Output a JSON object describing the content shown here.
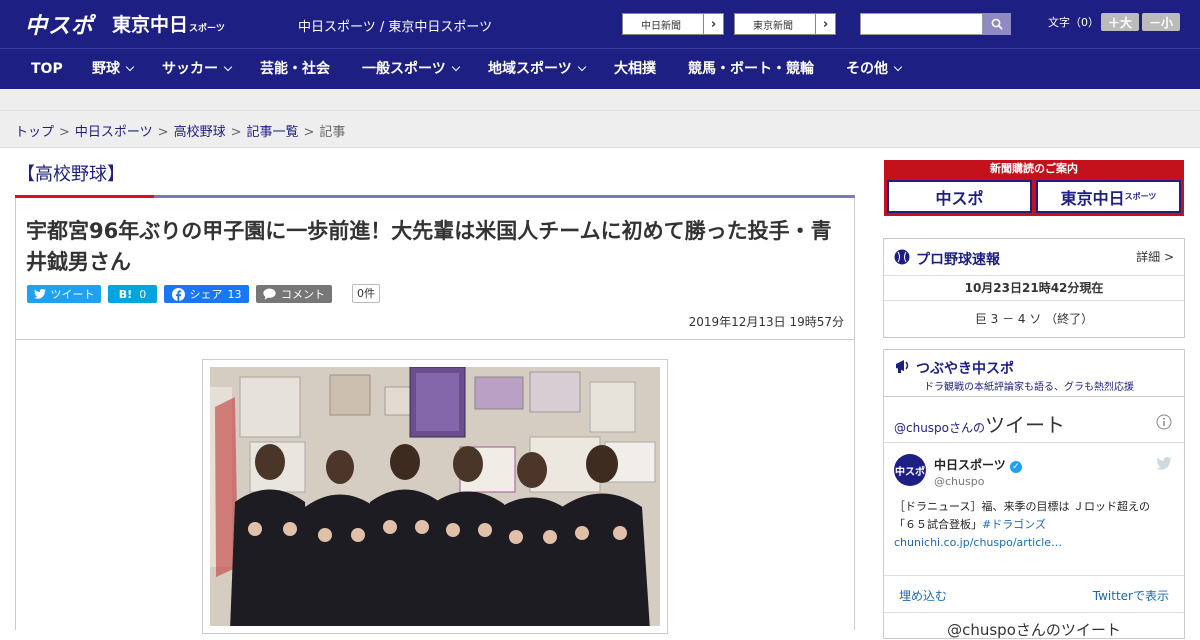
{
  "header": {
    "logo_main": "中スポ",
    "logo_tokyo": "東京中日",
    "logo_tokyo_sub": "スポーツ",
    "site_links": "中日スポーツ / 東京中日スポーツ",
    "newspaper1": "中日新聞",
    "newspaper2": "東京新聞",
    "search_placeholder": "",
    "font_size_label": "文字（0）",
    "font_larger": "＋大",
    "font_smaller": "－小"
  },
  "nav": [
    {
      "label": "TOP"
    },
    {
      "label": "野球"
    },
    {
      "label": "サッカー"
    },
    {
      "label": "芸能・社会"
    },
    {
      "label": "一般スポーツ"
    },
    {
      "label": "地域スポーツ"
    },
    {
      "label": "大相撲"
    },
    {
      "label": "競馬・ボート・競輪"
    },
    {
      "label": "その他"
    }
  ],
  "breadcrumb": {
    "items": [
      "トップ",
      "中日スポーツ",
      "高校野球",
      "記事一覧"
    ],
    "current": "記事",
    "separator": ">"
  },
  "article": {
    "category": "【高校野球】",
    "headline": "宇都宮96年ぶりの甲子園に一歩前進！大先輩は米国人チームに初めて勝った投手・青井鉞男さん",
    "share": {
      "tweet": "ツイート",
      "hatena": "B!",
      "hatena_count": "0",
      "facebook": "シェア",
      "facebook_count": "13",
      "comment": "コメント",
      "comment_count": "0件"
    },
    "date": "2019年12月13日 19時57分"
  },
  "sidebar": {
    "subscription": {
      "header": "新聞購読のご案内",
      "logo1": "中スポ",
      "logo2": "東京中日",
      "logo2_sub": "スポーツ"
    },
    "baseball": {
      "title": "プロ野球速報",
      "detail": "詳細 >",
      "timestamp": "10月23日21時42分現在",
      "score": "巨 3 － 4 ソ （終了）"
    },
    "tsubuyaki": {
      "title": "つぶやき中スポ",
      "subtitle": "ドラ観戦の本紙評論家も語る、グラも熱烈応援",
      "handle_line": "@chuspoさんの",
      "tweets_label": "ツイート",
      "tweet": {
        "account_name": "中日スポーツ",
        "account_handle": "@chuspo",
        "text_line1": "［ドラニュース］福、来季の目標は Ｊロッド超えの",
        "text_line2_pre": "「６５試合登板」",
        "hashtag": "#ドラゴンズ",
        "link": "chunichi.co.jp/chuspo/article…"
      },
      "embed": "埋め込む",
      "view_on_twitter": "Twitterで表示",
      "footer_partial": "@chuspoさんのツイート"
    }
  },
  "colors": {
    "brand_navy": "#1e1f83",
    "accent_red": "#d6121f",
    "twitter": "#1da1f2",
    "hatena": "#00a4de",
    "facebook": "#1877f2",
    "comment": "#777777"
  }
}
